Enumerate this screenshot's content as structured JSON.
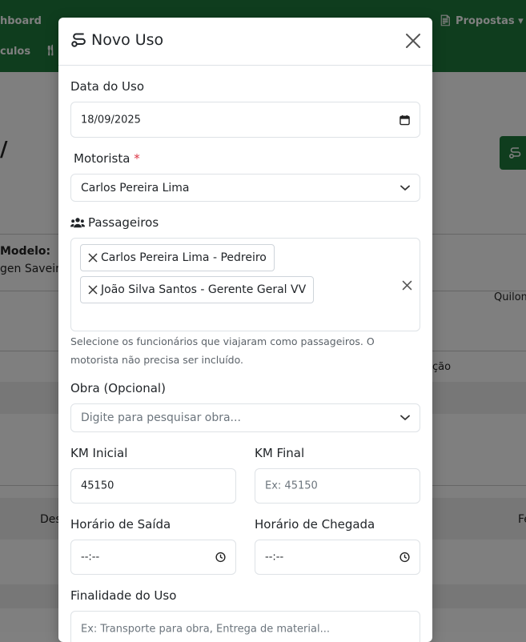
{
  "background": {
    "nav_items": [
      "hboard",
      "Propostas",
      "culos"
    ],
    "heading_fragment": "/",
    "modelo_label": "Modelo:",
    "modelo_value": "gen Saveiro",
    "col_quilometragem": "Quilom",
    "col_situacao": "ção",
    "col_des": "Des",
    "col_fe": "Fe"
  },
  "modal": {
    "title": "Novo Uso",
    "title_icon": "route-icon",
    "close_icon": "close-icon",
    "data_uso": {
      "label": "Data do Uso",
      "value": "18/09/2025",
      "icon": "calendar-icon"
    },
    "motorista": {
      "label": "Motorista",
      "required_mark": "*",
      "value": "Carlos Pereira Lima"
    },
    "passageiros": {
      "label": "Passageiros",
      "icon": "users-icon",
      "tags": [
        "Carlos Pereira Lima - Pedreiro",
        "João Silva Santos - Gerente Geral VV"
      ],
      "help": "Selecione os funcionários que viajaram como passageiros. O motorista não precisa ser incluído."
    },
    "obra": {
      "label": "Obra (Opcional)",
      "placeholder": "Digite para pesquisar obra..."
    },
    "km_inicial": {
      "label": "KM Inicial",
      "value": "45150"
    },
    "km_final": {
      "label": "KM Final",
      "placeholder": "Ex: 45150"
    },
    "horario_saida": {
      "label": "Horário de Saída",
      "value": "--:--",
      "icon": "clock-icon"
    },
    "horario_chegada": {
      "label": "Horário de Chegada",
      "value": "--:--",
      "icon": "clock-icon"
    },
    "finalidade": {
      "label": "Finalidade do Uso",
      "placeholder": "Ex: Transporte para obra, Entrega de material..."
    }
  },
  "colors": {
    "brand_green": "#1f7a3c",
    "required_red": "#dc3545",
    "overlay": "rgba(0,0,0,0.5)"
  }
}
